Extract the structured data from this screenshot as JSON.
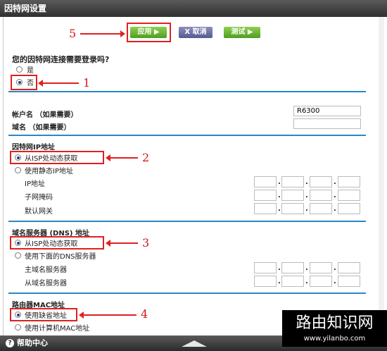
{
  "window": {
    "title": "因特网设置"
  },
  "toolbar": {
    "apply": "应用 ▶",
    "cancel": "X 取消",
    "test": "测试 ▶"
  },
  "login_question": {
    "label": "您的因特网连接需要登录吗?",
    "options": [
      "是",
      "否"
    ],
    "selected": "否"
  },
  "account": {
    "account_name_label": "帐户名 （如果需要）",
    "account_name_value": "R6300",
    "domain_label": "域名 （如果需要）",
    "domain_value": ""
  },
  "ip_section": {
    "title": "因特网IP地址",
    "options": [
      "从ISP处动态获取",
      "使用静态IP地址"
    ],
    "selected": "从ISP处动态获取",
    "fields": [
      "IP地址",
      "子网掩码",
      "默认网关"
    ]
  },
  "dns_section": {
    "title": "域名服务器 (DNS) 地址",
    "options": [
      "从ISP处动态获取",
      "使用下面的DNS服务器"
    ],
    "selected": "从ISP处动态获取",
    "fields": [
      "主域名服务器",
      "从域名服务器"
    ]
  },
  "mac_section": {
    "title": "路由器MAC地址",
    "options": [
      "使用缺省地址",
      "使用计算机MAC地址"
    ],
    "selected": "使用缺省地址"
  },
  "annotations": [
    "5",
    "1",
    "2",
    "3",
    "4"
  ],
  "footer": {
    "help": "帮助中心",
    "help_icon": "?"
  },
  "watermark": {
    "title": "路由知识网",
    "url": "www.yilanbo.com"
  },
  "colors": {
    "accent_line": "#2c87c4",
    "annotation_red": "#e02020",
    "apply_green": "#4f9e1f",
    "cancel_purple": "#545a93"
  }
}
